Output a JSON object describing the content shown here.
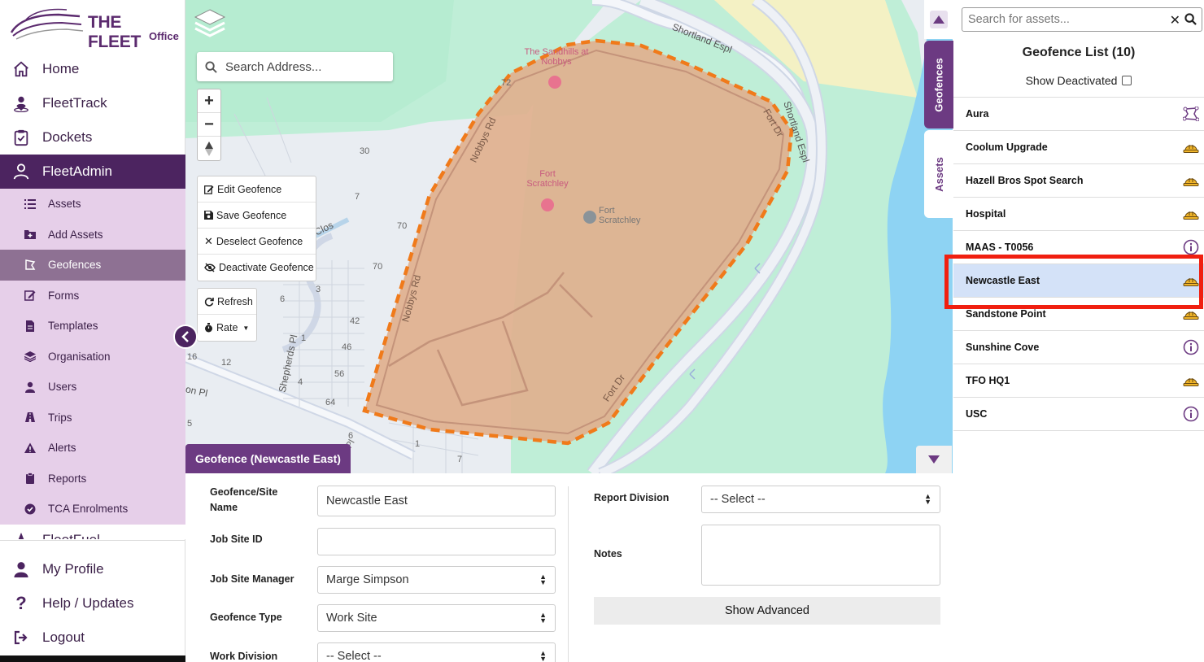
{
  "app": {
    "logo_title": "THE FLEET",
    "logo_sub": "Office"
  },
  "sidebar": {
    "items": [
      {
        "label": "Home",
        "icon": "home-icon"
      },
      {
        "label": "FleetTrack",
        "icon": "location-person-icon"
      },
      {
        "label": "Dockets",
        "icon": "clipboard-icon"
      },
      {
        "label": "FleetAdmin",
        "icon": "users-icon"
      }
    ],
    "sub_items": [
      {
        "label": "Assets",
        "icon": "list-icon"
      },
      {
        "label": "Add Assets",
        "icon": "folder-plus-icon"
      },
      {
        "label": "Geofences",
        "icon": "geofence-icon"
      },
      {
        "label": "Forms",
        "icon": "edit-icon"
      },
      {
        "label": "Templates",
        "icon": "file-icon"
      },
      {
        "label": "Organisation",
        "icon": "layers-icon"
      },
      {
        "label": "Users",
        "icon": "user-icon"
      },
      {
        "label": "Trips",
        "icon": "road-icon"
      },
      {
        "label": "Alerts",
        "icon": "warning-icon"
      },
      {
        "label": "Reports",
        "icon": "clipboard-icon"
      },
      {
        "label": "TCA Enrolments",
        "icon": "check-circle-icon"
      }
    ],
    "cut_item": "FleetFuel",
    "bottom_items": [
      {
        "label": "My Profile",
        "icon": "user-icon"
      },
      {
        "label": "Help / Updates",
        "icon": "question-icon"
      },
      {
        "label": "Logout",
        "icon": "logout-icon"
      }
    ]
  },
  "map": {
    "search_placeholder": "Search Address...",
    "zoom_in": "+",
    "zoom_out": "−",
    "tools": {
      "edit": "Edit Geofence",
      "save": "Save Geofence",
      "deselect": "Deselect Geofence",
      "deactivate": "Deactivate Geofence",
      "refresh": "Refresh",
      "rate": "Rate"
    },
    "labels": {
      "sandhills": "The Sandhills at Nobbys",
      "fort1": "Fort Scratchley",
      "fort2": "Fort Scratchley",
      "shortland1": "Shortland Espl",
      "shortland2": "Shortland Espl",
      "nobbys1": "Nobbys Rd",
      "nobbys2": "Nobbys Rd",
      "fortdr1": "Fort Dr",
      "fortdr2": "Fort Dr",
      "shepherds": "Shepherds Pl",
      "clos": "Clos",
      "onpl": "on Pl"
    },
    "numbers": [
      "72",
      "30",
      "7",
      "70",
      "70",
      "3",
      "6",
      "42",
      "1",
      "46",
      "56",
      "4",
      "64",
      "16",
      "12",
      "1",
      "7",
      "5",
      "6",
      "Pl"
    ],
    "geofence_tab": "Geofence (Newcastle East)"
  },
  "tabs": {
    "geofences": "Geofences",
    "assets": "Assets"
  },
  "right_panel": {
    "search_placeholder": "Search for assets...",
    "title": "Geofence List (10)",
    "show_deactivated": "Show Deactivated",
    "items": [
      {
        "name": "Aura",
        "icon": "polygon-icon"
      },
      {
        "name": "Coolum Upgrade",
        "icon": "hardhat-icon"
      },
      {
        "name": "Hazell Bros Spot Search",
        "icon": "hardhat-icon"
      },
      {
        "name": "Hospital",
        "icon": "hardhat-icon"
      },
      {
        "name": "MAAS - T0056",
        "icon": "info-icon"
      },
      {
        "name": "Newcastle East",
        "icon": "hardhat-icon",
        "selected": true
      },
      {
        "name": "Sandstone Point",
        "icon": "hardhat-icon"
      },
      {
        "name": "Sunshine Cove",
        "icon": "info-icon"
      },
      {
        "name": "TFO HQ1",
        "icon": "hardhat-icon"
      },
      {
        "name": "USC",
        "icon": "info-icon"
      }
    ]
  },
  "form": {
    "site_name_label": "Geofence/Site Name",
    "site_name_value": "Newcastle East",
    "job_site_id_label": "Job Site ID",
    "job_site_id_value": "",
    "manager_label": "Job Site Manager",
    "manager_value": "Marge Simpson",
    "type_label": "Geofence Type",
    "type_value": "Work Site",
    "work_division_label": "Work Division",
    "work_division_value": "-- Select --",
    "report_division_label": "Report Division",
    "report_division_value": "-- Select --",
    "notes_label": "Notes",
    "show_advanced": "Show Advanced"
  },
  "colors": {
    "brand_purple": "#4c2460",
    "tab_purple": "#6c3a82",
    "submenu_bg": "#e6cfe9",
    "geofence_fill": "#e0b08e",
    "geofence_stroke": "#f07a1a",
    "selected_row": "#d4e2f8",
    "highlight_box": "#f01f10",
    "hardhat": "#f0b52a"
  }
}
